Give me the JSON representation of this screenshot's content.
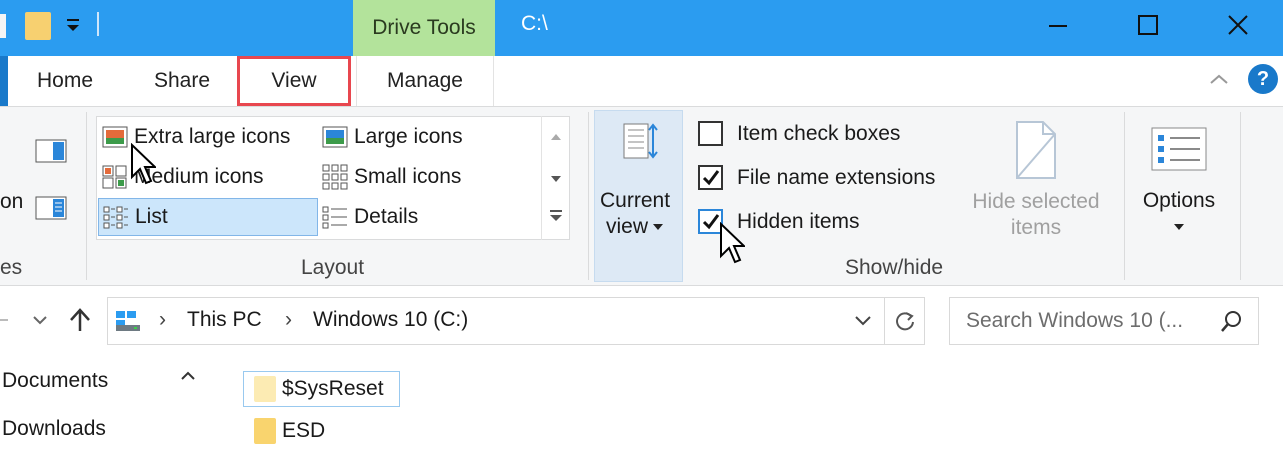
{
  "title_bar": {
    "contextual_tab": "Drive Tools",
    "window_title": "C:\\",
    "colors": {
      "bar": "#2b9cf0",
      "contextual": "#b3e39b"
    }
  },
  "tabs": [
    {
      "label": "Home"
    },
    {
      "label": "Share"
    },
    {
      "label": "View",
      "highlighted": true
    },
    {
      "label": "Manage"
    }
  ],
  "ribbon": {
    "panes_partial_label": "on",
    "panes_group_partial": "es",
    "layout": {
      "group_label": "Layout",
      "items": [
        {
          "label": "Extra large icons",
          "icon": "extra-large-icons-icon"
        },
        {
          "label": "Large icons",
          "icon": "large-icons-icon"
        },
        {
          "label": "Medium icons",
          "icon": "medium-icons-icon"
        },
        {
          "label": "Small icons",
          "icon": "small-icons-icon"
        },
        {
          "label": "List",
          "icon": "list-icon",
          "selected": true
        },
        {
          "label": "Details",
          "icon": "details-icon"
        }
      ]
    },
    "current_view": {
      "line1": "Current",
      "line2": "view"
    },
    "show_hide": {
      "group_label": "Show/hide",
      "checkboxes": [
        {
          "label": "Item check boxes",
          "checked": false
        },
        {
          "label": "File name extensions",
          "checked": true
        },
        {
          "label": "Hidden items",
          "checked": true
        }
      ],
      "hide_selected": {
        "line1": "Hide selected",
        "line2": "items"
      }
    },
    "options": {
      "label": "Options"
    }
  },
  "address": {
    "crumbs": [
      "This PC",
      "Windows 10 (C:)"
    ],
    "search_placeholder": "Search Windows 10 (..."
  },
  "nav_pane": {
    "items": [
      {
        "label": "Documents"
      },
      {
        "label": "Downloads"
      }
    ]
  },
  "files": [
    {
      "name": "$SysReset",
      "selected": true
    },
    {
      "name": "ESD",
      "selected": false
    }
  ]
}
